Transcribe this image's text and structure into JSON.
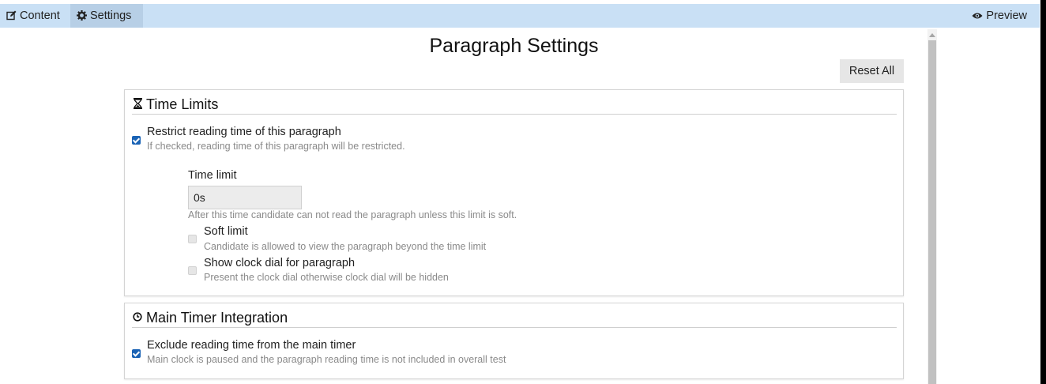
{
  "toolbar": {
    "tabs": [
      {
        "label": "Content",
        "icon": "edit-icon"
      },
      {
        "label": "Settings",
        "icon": "gear-icon"
      }
    ],
    "preview": {
      "label": "Preview",
      "icon": "eye-icon"
    }
  },
  "page": {
    "title": "Paragraph Settings",
    "reset_label": "Reset All"
  },
  "time_limits": {
    "title": "Time Limits",
    "icon": "hourglass-icon",
    "restrict": {
      "label": "Restrict reading time of this paragraph",
      "help": "If checked, reading time of this paragraph will be restricted.",
      "checked": true
    },
    "time_limit": {
      "label": "Time limit",
      "value": "0s",
      "help": "After this time candidate can not read the paragraph unless this limit is soft."
    },
    "soft_limit": {
      "label": "Soft limit",
      "help": "Candidate is allowed to view the paragraph beyond the time limit",
      "checked": false
    },
    "clock_dial": {
      "label": "Show clock dial for paragraph",
      "help": "Present the clock dial otherwise clock dial will be hidden",
      "checked": false
    }
  },
  "main_timer": {
    "title": "Main Timer Integration",
    "icon": "clock-icon",
    "exclude": {
      "label": "Exclude reading time from the main timer",
      "help": "Main clock is paused and the paragraph reading time is not included in overall test",
      "checked": true
    }
  },
  "colors": {
    "toolbar_bg": "#c9e0f5",
    "active_tab_bg": "#b7cfe6",
    "checkbox_on": "#1a63b5"
  }
}
